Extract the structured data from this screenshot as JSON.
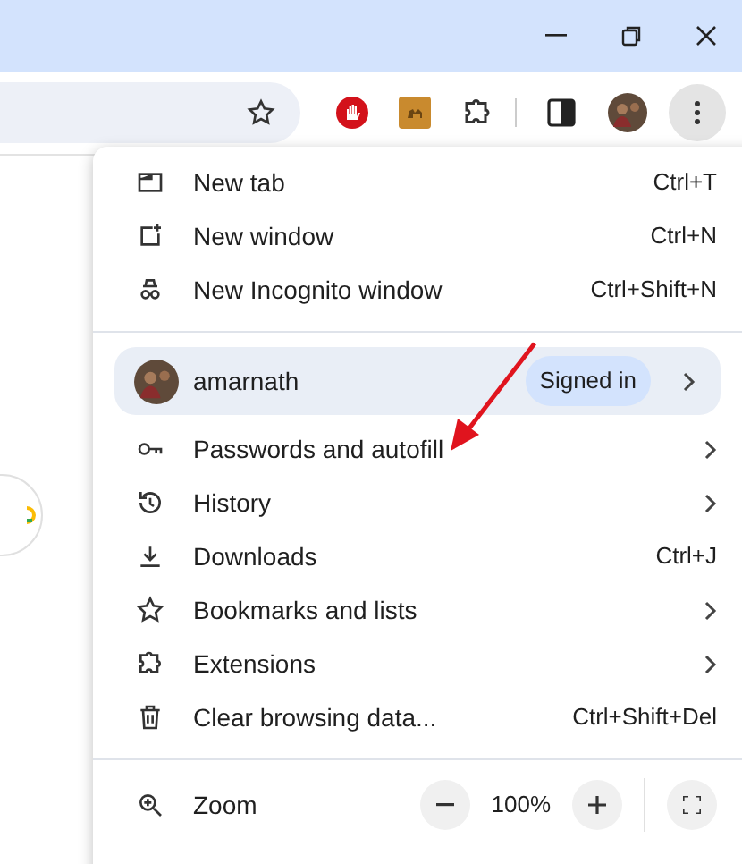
{
  "menu": {
    "sections": [
      {
        "items": [
          {
            "kind": "item",
            "label": "New tab",
            "shortcut": "Ctrl+T",
            "has_submenu": false
          },
          {
            "kind": "item",
            "label": "New window",
            "shortcut": "Ctrl+N",
            "has_submenu": false
          },
          {
            "kind": "item",
            "label": "New Incognito window",
            "shortcut": "Ctrl+Shift+N",
            "has_submenu": false
          }
        ]
      },
      {
        "items": [
          {
            "kind": "profile",
            "label": "amarnath",
            "badge": "Signed in",
            "has_submenu": true
          },
          {
            "kind": "item",
            "label": "Passwords and autofill",
            "has_submenu": true
          },
          {
            "kind": "item",
            "label": "History",
            "has_submenu": true
          },
          {
            "kind": "item",
            "label": "Downloads",
            "shortcut": "Ctrl+J",
            "has_submenu": false
          },
          {
            "kind": "item",
            "label": "Bookmarks and lists",
            "has_submenu": true
          },
          {
            "kind": "item",
            "label": "Extensions",
            "has_submenu": true
          },
          {
            "kind": "item",
            "label": "Clear browsing data...",
            "shortcut": "Ctrl+Shift+Del",
            "has_submenu": false
          }
        ]
      },
      {
        "items": [
          {
            "kind": "zoom",
            "label": "Zoom",
            "value": "100%"
          }
        ]
      }
    ]
  }
}
